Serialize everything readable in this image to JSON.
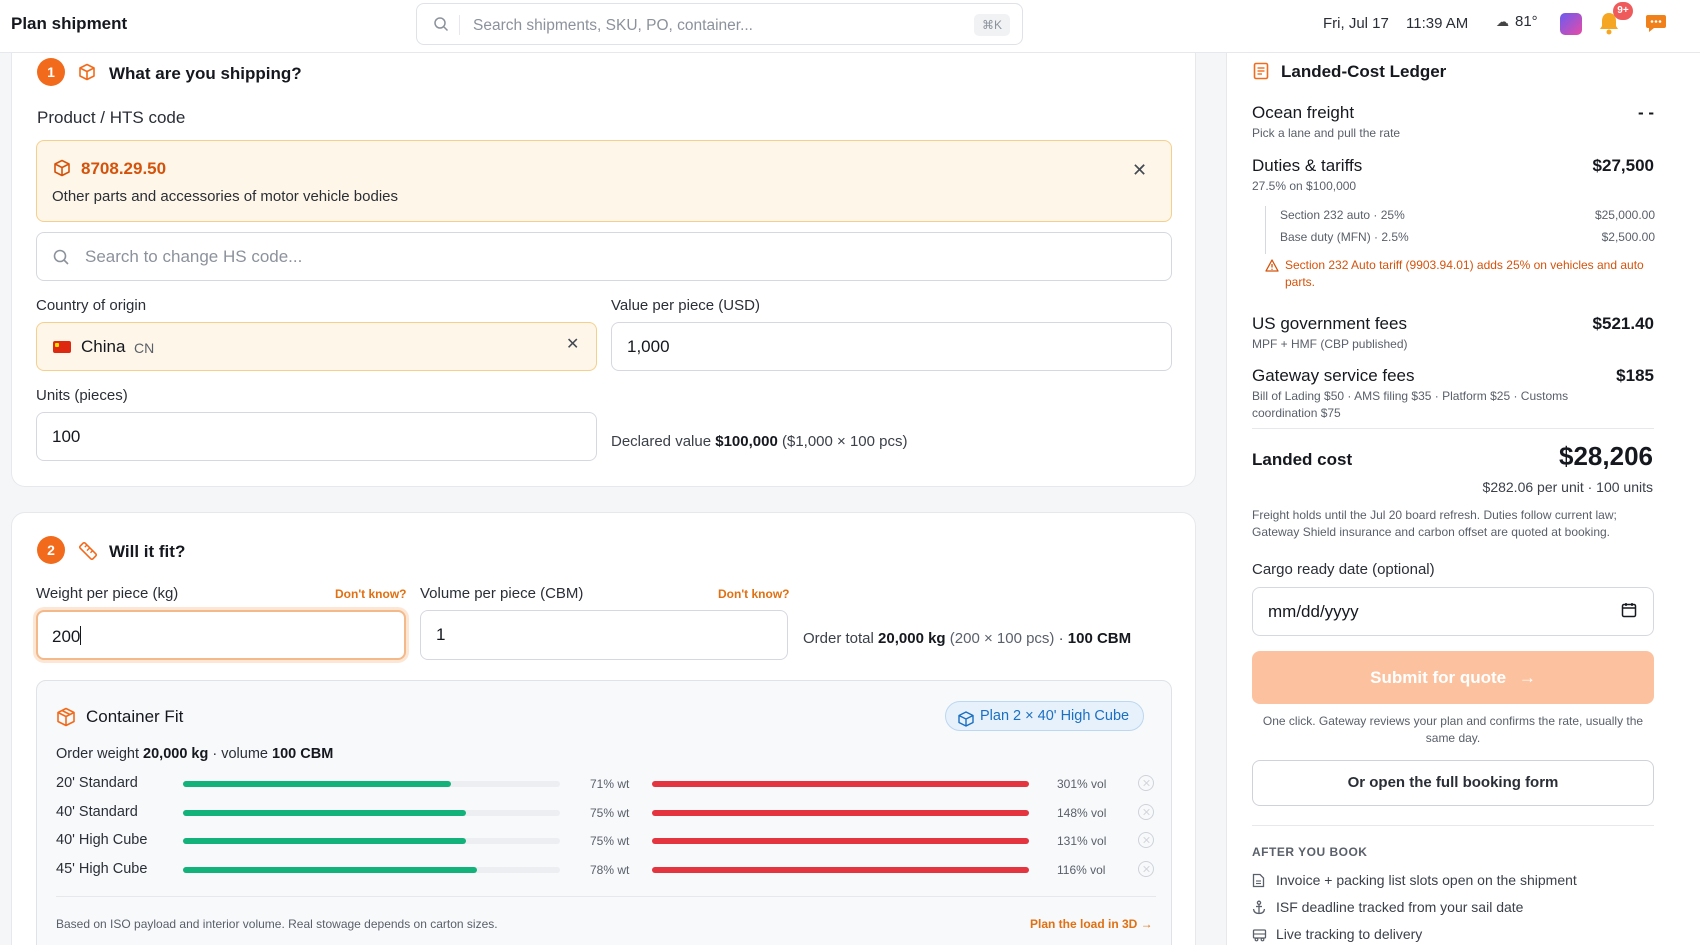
{
  "header": {
    "title": "Plan shipment",
    "search_placeholder": "Search shipments, SKU, PO, container...",
    "search_shortcut": "⌘K",
    "date": "Fri, Jul 17",
    "time": "11:39 AM",
    "weather": "81°",
    "notifications_badge": "9+"
  },
  "step1": {
    "number": "1",
    "title": "What are you shipping?",
    "product_label": "Product / HTS code",
    "hts_code": "8708.29.50",
    "hts_description": "Other parts and accessories of motor vehicle bodies",
    "hs_search_placeholder": "Search to change HS code...",
    "origin_label": "Country of origin",
    "origin_value": "China",
    "origin_code": "CN",
    "value_label": "Value per piece (USD)",
    "value": "1,000",
    "units_label": "Units (pieces)",
    "units": "100",
    "declared_prefix": "Declared value",
    "declared_value": "$100,000",
    "declared_detail": "($1,000 × 100 pcs)"
  },
  "step2": {
    "number": "2",
    "title": "Will it fit?",
    "weight_label": "Weight per piece (kg)",
    "weight_value": "200",
    "volume_label": "Volume per piece (CBM)",
    "volume_value": "1",
    "dont_know": "Don't know?",
    "order_total_prefix": "Order total",
    "order_total_weight": "20,000 kg",
    "order_total_detail": "(200 × 100 pcs)",
    "order_total_sep": "·",
    "order_total_volume": "100 CBM"
  },
  "container_fit": {
    "title": "Container Fit",
    "plan": "Plan 2 × 40' High Cube",
    "summary_prefix": "Order weight",
    "summary_weight": "20,000 kg",
    "summary_mid": "· volume",
    "summary_volume": "100 CBM",
    "rows": [
      {
        "name": "20' Standard",
        "wt_fraction": 0.71,
        "wt_label": "71% wt",
        "vol_fraction": 1.0,
        "vol_label": "301% vol"
      },
      {
        "name": "40' Standard",
        "wt_fraction": 0.75,
        "wt_label": "75% wt",
        "vol_fraction": 1.0,
        "vol_label": "148% vol"
      },
      {
        "name": "40' High Cube",
        "wt_fraction": 0.75,
        "wt_label": "75% wt",
        "vol_fraction": 1.0,
        "vol_label": "131% vol"
      },
      {
        "name": "45' High Cube",
        "wt_fraction": 0.78,
        "wt_label": "78% wt",
        "vol_fraction": 1.0,
        "vol_label": "116% vol"
      }
    ],
    "footnote": "Based on ISO payload and interior volume. Real stowage depends on carton sizes.",
    "plan_3d_link": "Plan the load in 3D →"
  },
  "ledger": {
    "title": "Landed-Cost Ledger",
    "ocean": {
      "name": "Ocean freight",
      "sub": "Pick a lane and pull the rate",
      "amount": "- -"
    },
    "duties": {
      "name": "Duties & tariffs",
      "sub": "27.5% on $100,000",
      "amount": "$27,500",
      "breakdown": [
        {
          "label": "Section 232 auto · 25%",
          "amount": "$25,000.00"
        },
        {
          "label": "Base duty (MFN) · 2.5%",
          "amount": "$2,500.00"
        }
      ],
      "warning": "Section 232 Auto tariff (9903.94.01) adds 25% on vehicles and auto parts."
    },
    "gov_fees": {
      "name": "US government fees",
      "sub": "MPF + HMF (CBP published)",
      "amount": "$521.40"
    },
    "gateway_fees": {
      "name": "Gateway service fees",
      "sub": "Bill of Lading $50 · AMS filing $35 · Platform $25 · Customs coordination $75",
      "amount": "$185"
    },
    "landed_label": "Landed cost",
    "landed_total": "$28,206",
    "landed_unit": "$282.06 per unit · 100 units",
    "note": "Freight holds until the Jul 20 board refresh. Duties follow current law; Gateway Shield insurance and carbon offset are quoted at booking.",
    "ready_label": "Cargo ready date (optional)",
    "ready_placeholder": "mm/dd/yyyy",
    "submit": "Submit for quote",
    "submit_note": "One click. Gateway reviews your plan and confirms the rate, usually the same day.",
    "open_form": "Or open the full booking form",
    "after_title": "AFTER YOU BOOK",
    "after_items": [
      "Invoice + packing list slots open on the shipment",
      "ISF deadline tracked from your sail date",
      "Live tracking to delivery"
    ]
  },
  "colors": {
    "accent": "#f26a1b",
    "green": "#13b27a",
    "red": "#e3343f",
    "plan_blue": "#1b6fc2"
  }
}
